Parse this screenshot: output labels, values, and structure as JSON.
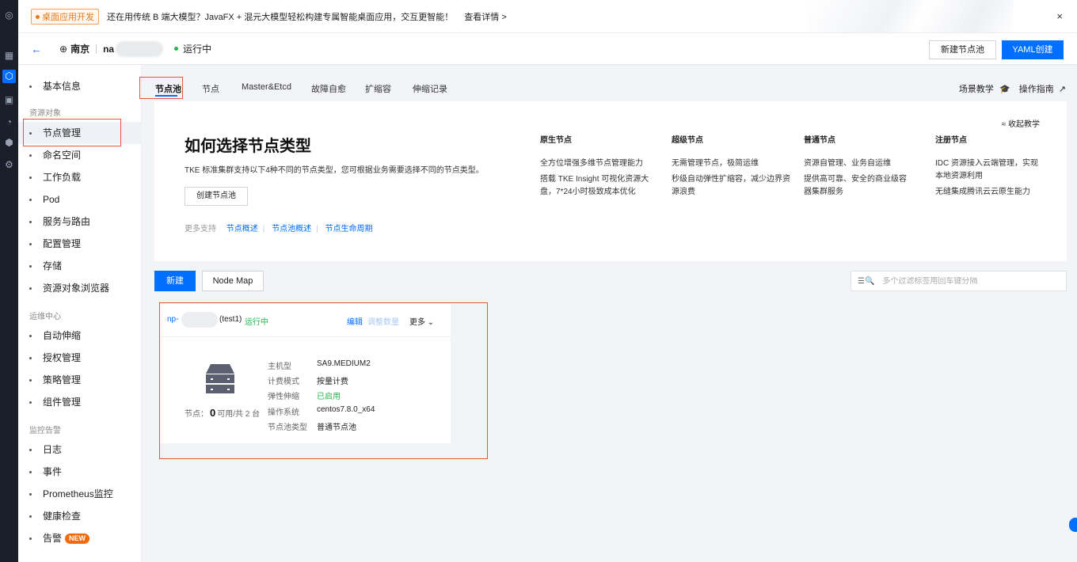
{
  "banner": {
    "tag": "桌面应用开发",
    "text": "还在用传统 B 端大模型？JavaFX + 混元大模型轻松构建专属智能桌面应用，交互更智能！",
    "link": "查看详情 >",
    "close": "×"
  },
  "header": {
    "back": "←",
    "region": "南京",
    "cluster_prefix": "na",
    "status": "运行中",
    "new_pool_btn": "新建节点池",
    "yaml_btn": "YAML创建"
  },
  "sidebar": {
    "items_top": [
      {
        "label": "基本信息"
      }
    ],
    "section_resources": "资源对象",
    "items_resources": [
      {
        "label": "节点管理"
      },
      {
        "label": "命名空间"
      },
      {
        "label": "工作负载"
      },
      {
        "label": "Pod"
      },
      {
        "label": "服务与路由"
      },
      {
        "label": "配置管理"
      },
      {
        "label": "存储"
      },
      {
        "label": "资源对象浏览器"
      }
    ],
    "section_ops": "运维中心",
    "items_ops": [
      {
        "label": "自动伸缩"
      },
      {
        "label": "授权管理"
      },
      {
        "label": "策略管理"
      },
      {
        "label": "组件管理"
      }
    ],
    "section_monitor": "监控告警",
    "items_monitor": [
      {
        "label": "日志"
      },
      {
        "label": "事件"
      },
      {
        "label": "Prometheus监控"
      },
      {
        "label": "健康检查"
      },
      {
        "label": "告警"
      }
    ],
    "new_badge": "NEW"
  },
  "tabs": [
    {
      "label": "节点池"
    },
    {
      "label": "节点"
    },
    {
      "label": "Master&Etcd"
    },
    {
      "label": "故障自愈"
    },
    {
      "label": "扩缩容"
    },
    {
      "label": "伸缩记录"
    }
  ],
  "top_links": {
    "scene": "场景教学",
    "guide": "操作指南"
  },
  "intro": {
    "title": "如何选择节点类型",
    "desc": "TKE 标准集群支持以下4种不同的节点类型，您可根据业务需要选择不同的节点类型。",
    "create_btn": "创建节点池",
    "more_label": "更多支持",
    "links": [
      "节点概述",
      "节点池概述",
      "节点生命周期"
    ],
    "collapse": "收起教学",
    "types": [
      {
        "title": "原生节点",
        "lines": [
          "全方位增强多维节点管理能力",
          "搭载 TKE Insight 可视化资源大盘，7*24小时极致成本优化"
        ]
      },
      {
        "title": "超级节点",
        "lines": [
          "无需管理节点，极简运维",
          "秒级自动弹性扩缩容，减少边界资源浪费"
        ]
      },
      {
        "title": "普通节点",
        "lines": [
          "资源自管理、业务自运维",
          "提供高可靠、安全的商业级容器集群服务"
        ]
      },
      {
        "title": "注册节点",
        "lines": [
          "IDC 资源接入云端管理，实现本地资源利用",
          "无缝集成腾讯云云原生能力"
        ]
      }
    ]
  },
  "toolbar": {
    "add_btn": "新建",
    "nodemap_btn": "Node Map",
    "search_placeholder": "多个过滤标签用回车键分隔"
  },
  "pool_card": {
    "id_prefix": "np-",
    "name": "(test1)",
    "status": "运行中",
    "edit": "编辑",
    "adjust": "调整数量",
    "more": "更多",
    "node_label": "节点：",
    "node_available": "0",
    "node_suffix": "可用/共 2 台",
    "props": [
      {
        "k": "主机型",
        "v": "SA9.MEDIUM2"
      },
      {
        "k": "计费模式",
        "v": "按量计费"
      },
      {
        "k": "弹性伸缩",
        "v": "已启用"
      },
      {
        "k": "操作系统",
        "v": "centos7.8.0_x64"
      },
      {
        "k": "节点池类型",
        "v": "普通节点池"
      }
    ]
  }
}
